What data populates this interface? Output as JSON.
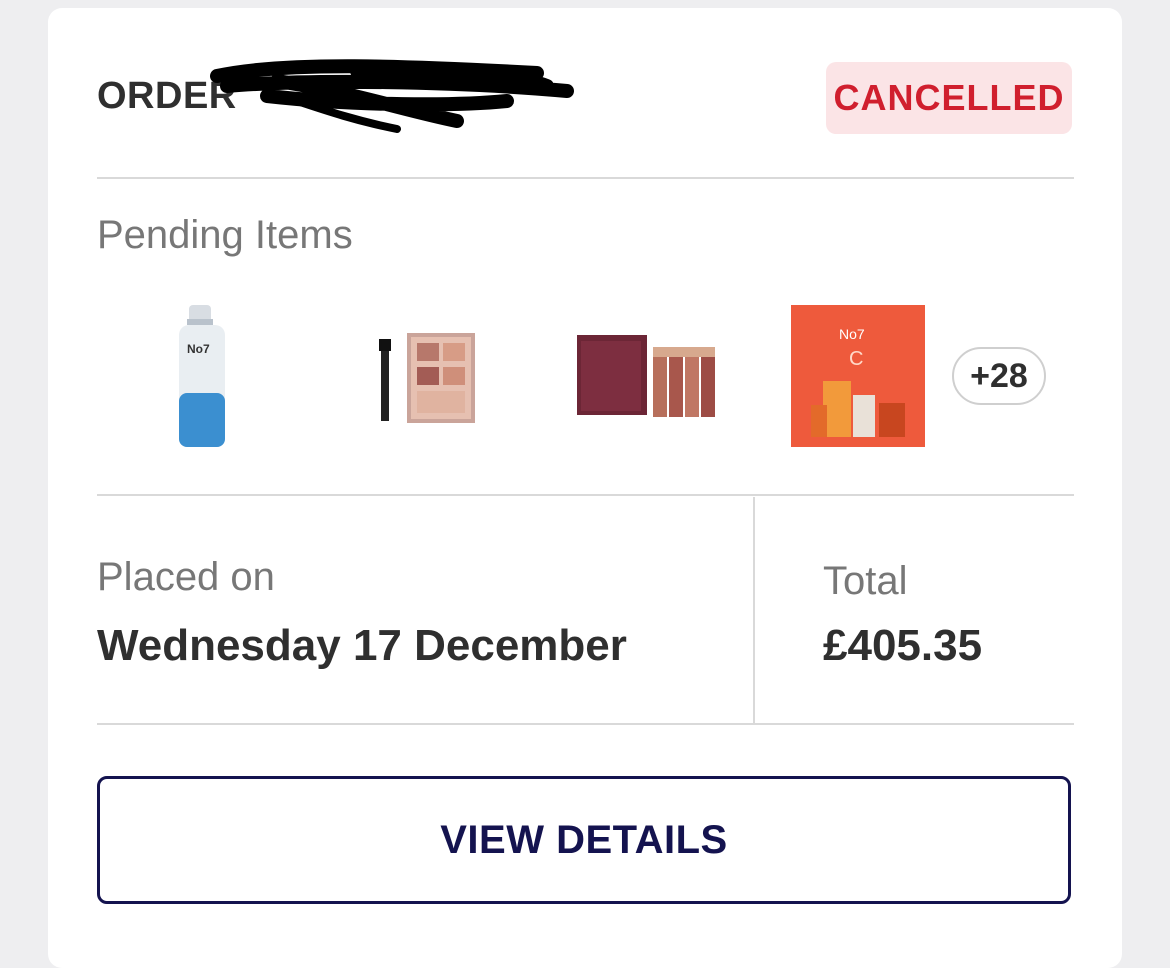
{
  "order": {
    "label": "ORDER",
    "status": "CANCELLED"
  },
  "pending": {
    "label": "Pending Items",
    "items": [
      {
        "name": "bottle-product"
      },
      {
        "name": "palette-product"
      },
      {
        "name": "lipstick-set-product"
      },
      {
        "name": "vitamin-c-gift-set-product"
      }
    ],
    "more_count": "+28"
  },
  "placed": {
    "label": "Placed on",
    "value": "Wednesday 17 December"
  },
  "total": {
    "label": "Total",
    "value": "£405.35"
  },
  "actions": {
    "view_details": "VIEW DETAILS"
  },
  "colors": {
    "status_text": "#d01f2e",
    "status_bg": "#fbe4e6",
    "button_navy": "#14134f"
  }
}
